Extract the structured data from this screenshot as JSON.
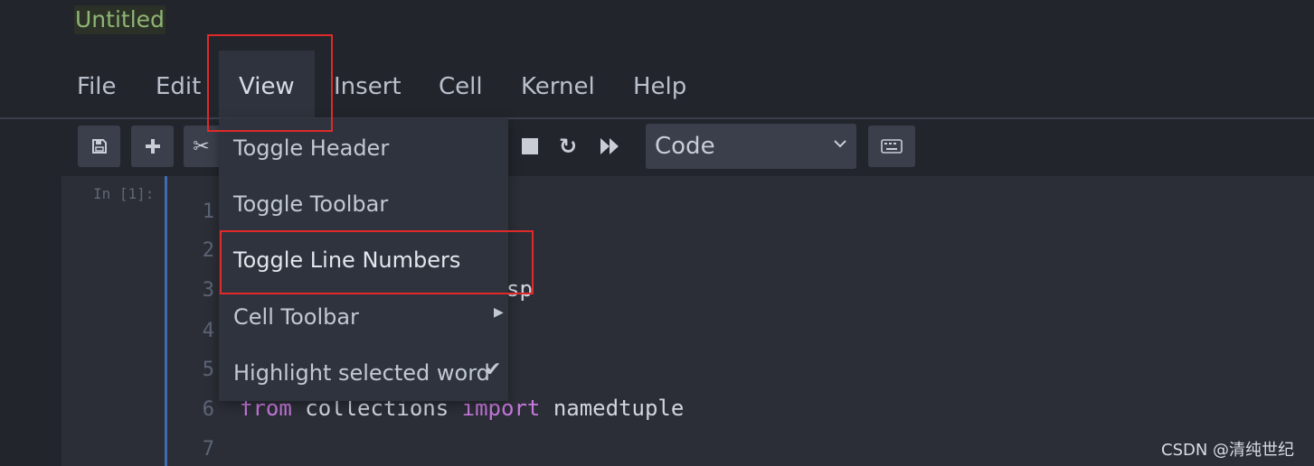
{
  "window": {
    "title": "Untitled"
  },
  "menubar": {
    "items": [
      "File",
      "Edit",
      "View",
      "Insert",
      "Cell",
      "Kernel",
      "Help"
    ],
    "active": "View"
  },
  "toolbar": {
    "save_icon": "save-icon",
    "add_icon": "plus-icon",
    "cut_icon": "scissors-icon",
    "stop_icon": "stop-icon",
    "restart_icon": "restart-icon",
    "run_all_icon": "fast-forward-icon",
    "cell_type": "Code",
    "keyboard_icon": "keyboard-icon"
  },
  "view_menu": {
    "items": [
      {
        "label": "Toggle Header"
      },
      {
        "label": "Toggle Toolbar"
      },
      {
        "label": "Toggle Line Numbers",
        "highlighted": true
      },
      {
        "label": "Cell Toolbar",
        "submenu": true
      },
      {
        "label": "Highlight selected word",
        "checked": true
      }
    ]
  },
  "cell": {
    "prompt": "In [1]:",
    "line_numbers": [
      "1",
      "2",
      "3",
      "4",
      "5",
      "6",
      "7"
    ],
    "visible_code": {
      "line3_tail": "sp",
      "line6": {
        "kw1": "from",
        "mod": "collections",
        "kw2": "import",
        "name": "namedtuple"
      }
    }
  },
  "watermark": "CSDN @清纯世纪",
  "colors": {
    "background": "#22252c",
    "menu_bg": "#2f333d",
    "title_green": "#8fb573",
    "keyword": "#c678dd",
    "annotation_red": "#e02a2a",
    "cell_edge": "#3f6cb0"
  }
}
